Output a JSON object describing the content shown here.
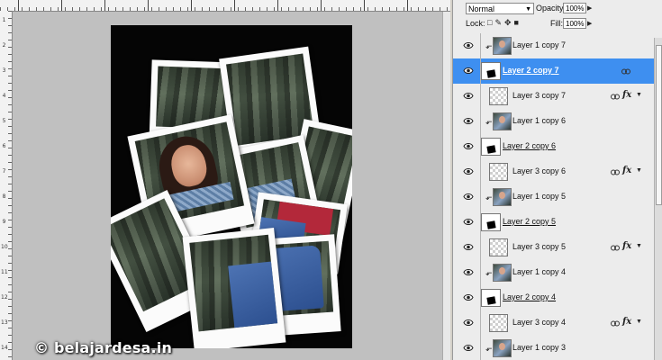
{
  "watermark": "© belajardesa.in",
  "ruler": {
    "left_marks": [
      "1",
      "2",
      "3",
      "4",
      "5",
      "6",
      "7",
      "8",
      "9",
      "10",
      "11",
      "12",
      "13",
      "14"
    ]
  },
  "layers_panel": {
    "blend_mode": "Normal",
    "opacity_label": "Opacity:",
    "opacity_value": "100%",
    "lock_label": "Lock:",
    "fill_label": "Fill:",
    "fill_value": "100%",
    "layers": [
      {
        "name": "Layer 1 copy 7",
        "kind": "photo",
        "clipped": true,
        "fx": false,
        "selected": false
      },
      {
        "name": "Layer 2 copy 7",
        "kind": "shape",
        "clipped": false,
        "fx": false,
        "selected": true
      },
      {
        "name": "Layer 3 copy 7",
        "kind": "transparent",
        "clipped": false,
        "fx": true,
        "selected": false
      },
      {
        "name": "Layer 1 copy 6",
        "kind": "photo",
        "clipped": true,
        "fx": false,
        "selected": false
      },
      {
        "name": "Layer 2 copy 6",
        "kind": "shape",
        "clipped": false,
        "fx": false,
        "selected": false
      },
      {
        "name": "Layer 3 copy 6",
        "kind": "transparent",
        "clipped": false,
        "fx": true,
        "selected": false
      },
      {
        "name": "Layer 1 copy 5",
        "kind": "photo",
        "clipped": true,
        "fx": false,
        "selected": false
      },
      {
        "name": "Layer 2 copy 5",
        "kind": "shape",
        "clipped": false,
        "fx": false,
        "selected": false
      },
      {
        "name": "Layer 3 copy 5",
        "kind": "transparent",
        "clipped": false,
        "fx": true,
        "selected": false
      },
      {
        "name": "Layer 1 copy 4",
        "kind": "photo",
        "clipped": true,
        "fx": false,
        "selected": false
      },
      {
        "name": "Layer 2 copy 4",
        "kind": "shape",
        "clipped": false,
        "fx": false,
        "selected": false
      },
      {
        "name": "Layer 3 copy 4",
        "kind": "transparent",
        "clipped": false,
        "fx": true,
        "selected": false
      },
      {
        "name": "Layer 1 copy 3",
        "kind": "photo",
        "clipped": true,
        "fx": false,
        "selected": false
      }
    ]
  },
  "colors": {
    "selected_row": "#3e8ff0",
    "document_background": "#050505",
    "pasteboard": "#c0c0c0"
  }
}
